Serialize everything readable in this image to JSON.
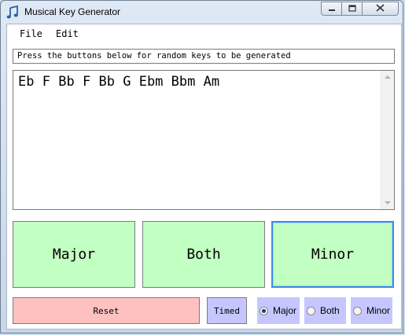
{
  "window": {
    "title": "Musical Key Generator"
  },
  "menu": {
    "items": [
      {
        "label": "File"
      },
      {
        "label": "Edit"
      }
    ]
  },
  "status": {
    "text": "Press the buttons below for random keys to be generated"
  },
  "output": {
    "keys": [
      "Eb",
      "F",
      "Bb",
      "F",
      "Bb",
      "G",
      "Ebm",
      "Bbm",
      "Am"
    ]
  },
  "buttons": {
    "major": "Major",
    "both": "Both",
    "minor": "Minor",
    "reset": "Reset",
    "timed": "Timed"
  },
  "radio": {
    "options": [
      {
        "label": "Major",
        "selected": true
      },
      {
        "label": "Both",
        "selected": false
      },
      {
        "label": "Minor",
        "selected": false
      }
    ]
  },
  "colors": {
    "major_button": "#c2ffc2",
    "reset_button": "#ffc0c0",
    "timed_button": "#c6c6ff",
    "focus_border": "#3d8ee0"
  },
  "icons": {
    "app": "music-note-icon"
  }
}
